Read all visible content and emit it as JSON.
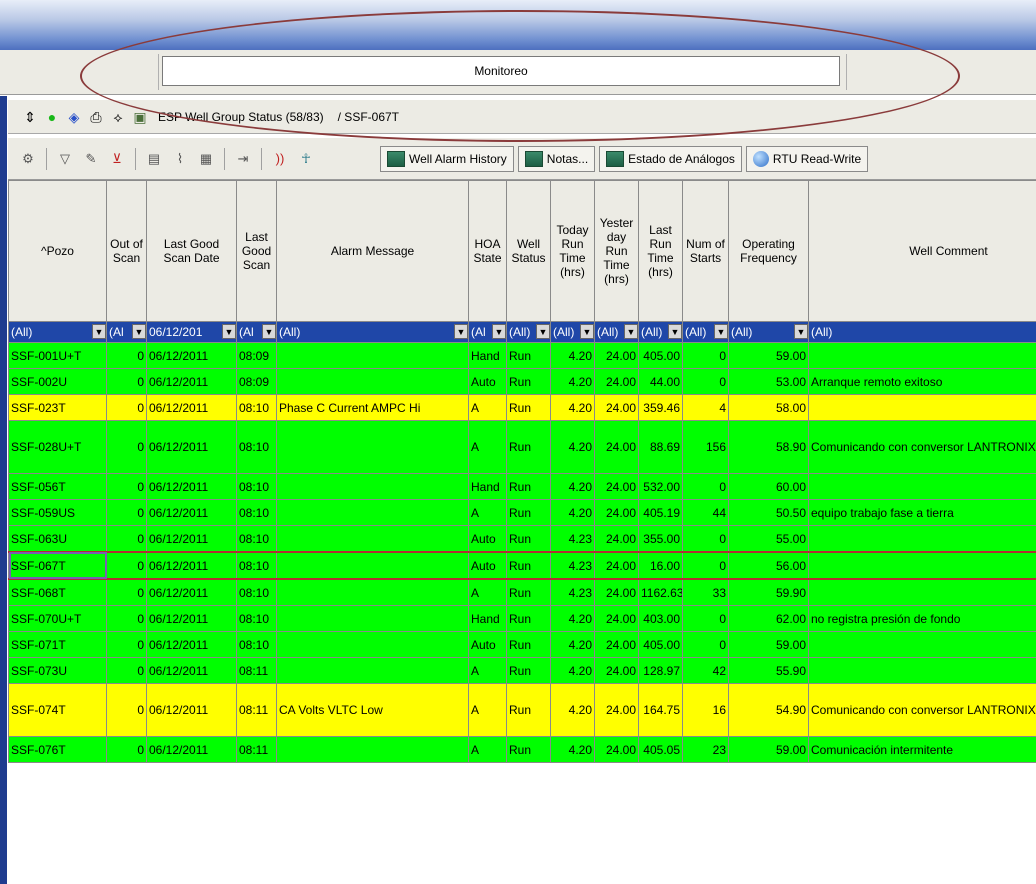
{
  "window": {
    "panel_title": "Monitoreo"
  },
  "group": {
    "title": "ESP Well Group Status (58/83)",
    "path": "/ SSF-067T"
  },
  "toolbar": {
    "tabs": [
      {
        "label": "Well Alarm History",
        "icon": "table-icon"
      },
      {
        "label": "Notas...",
        "icon": "table-icon"
      },
      {
        "label": "Estado de Análogos",
        "icon": "table-icon"
      },
      {
        "label": "RTU Read-Write",
        "icon": "globe-icon"
      }
    ]
  },
  "columns": [
    "^Pozo",
    "Out of Scan",
    "Last Good Scan Date",
    "Last Good Scan",
    "Alarm Message",
    "HOA State",
    "Well Status",
    "Today Run Time (hrs)",
    "Yester day Run Time (hrs)",
    "Last Run Time (hrs)",
    "Num of Starts",
    "Operating Frequency",
    "Well Comment"
  ],
  "filters": [
    "(All)",
    "(Al",
    "06/12/201",
    "(Al",
    "(All)",
    "(Al",
    "(All)",
    "(All)",
    "(All)",
    "(All)",
    "(All)",
    "(All)",
    "(All)"
  ],
  "rows": [
    {
      "color": "green",
      "cells": [
        "SSF-001U+T",
        "0",
        "06/12/2011",
        "08:09",
        "",
        "Hand",
        "Run",
        "4.20",
        "24.00",
        "405.00",
        "0",
        "59.00",
        ""
      ]
    },
    {
      "color": "green",
      "cells": [
        "SSF-002U",
        "0",
        "06/12/2011",
        "08:09",
        "",
        "Auto",
        "Run",
        "4.20",
        "24.00",
        "44.00",
        "0",
        "53.00",
        "Arranque remoto exitoso"
      ]
    },
    {
      "color": "yellow",
      "cells": [
        "SSF-023T",
        "0",
        "06/12/2011",
        "08:10",
        "Phase C Current AMPC Hi",
        "A",
        "Run",
        "4.20",
        "24.00",
        "359.46",
        "4",
        "58.00",
        ""
      ]
    },
    {
      "color": "green",
      "tall": true,
      "cells": [
        "SSF-028U+T",
        "0",
        "06/12/2011",
        "08:10",
        "",
        "A",
        "Run",
        "4.20",
        "24.00",
        "88.69",
        "156",
        "58.90",
        "Comunicando con conversor LANTRONIX"
      ]
    },
    {
      "color": "green",
      "cells": [
        "SSF-056T",
        "0",
        "06/12/2011",
        "08:10",
        "",
        "Hand",
        "Run",
        "4.20",
        "24.00",
        "532.00",
        "0",
        "60.00",
        ""
      ]
    },
    {
      "color": "green",
      "cells": [
        "SSF-059US",
        "0",
        "06/12/2011",
        "08:10",
        "",
        "A",
        "Run",
        "4.20",
        "24.00",
        "405.19",
        "44",
        "50.50",
        "equipo trabajo fase a tierra"
      ]
    },
    {
      "color": "green",
      "cells": [
        "SSF-063U",
        "0",
        "06/12/2011",
        "08:10",
        "",
        "Auto",
        "Run",
        "4.23",
        "24.00",
        "355.00",
        "0",
        "55.00",
        ""
      ]
    },
    {
      "color": "green",
      "selected": true,
      "cells": [
        "SSF-067T",
        "0",
        "06/12/2011",
        "08:10",
        "",
        "Auto",
        "Run",
        "4.23",
        "24.00",
        "16.00",
        "0",
        "56.00",
        ""
      ]
    },
    {
      "color": "green",
      "cells": [
        "SSF-068T",
        "0",
        "06/12/2011",
        "08:10",
        "",
        "A",
        "Run",
        "4.23",
        "24.00",
        "1162.63",
        "33",
        "59.90",
        ""
      ]
    },
    {
      "color": "green",
      "cells": [
        "SSF-070U+T",
        "0",
        "06/12/2011",
        "08:10",
        "",
        "Hand",
        "Run",
        "4.20",
        "24.00",
        "403.00",
        "0",
        "62.00",
        "no registra presión de fondo"
      ]
    },
    {
      "color": "green",
      "cells": [
        "SSF-071T",
        "0",
        "06/12/2011",
        "08:10",
        "",
        "Auto",
        "Run",
        "4.20",
        "24.00",
        "405.00",
        "0",
        "59.00",
        ""
      ]
    },
    {
      "color": "green",
      "cells": [
        "SSF-073U",
        "0",
        "06/12/2011",
        "08:11",
        "",
        "A",
        "Run",
        "4.20",
        "24.00",
        "128.97",
        "42",
        "55.90",
        ""
      ]
    },
    {
      "color": "yellow",
      "tall": true,
      "cells": [
        "SSF-074T",
        "0",
        "06/12/2011",
        "08:11",
        "CA Volts VLTC Low",
        "A",
        "Run",
        "4.20",
        "24.00",
        "164.75",
        "16",
        "54.90",
        "Comunicando con conversor LANTRONIX"
      ]
    },
    {
      "color": "green",
      "cells": [
        "SSF-076T",
        "0",
        "06/12/2011",
        "08:11",
        "",
        "A",
        "Run",
        "4.20",
        "24.00",
        "405.05",
        "23",
        "59.00",
        "Comunicación intermitente"
      ]
    }
  ]
}
